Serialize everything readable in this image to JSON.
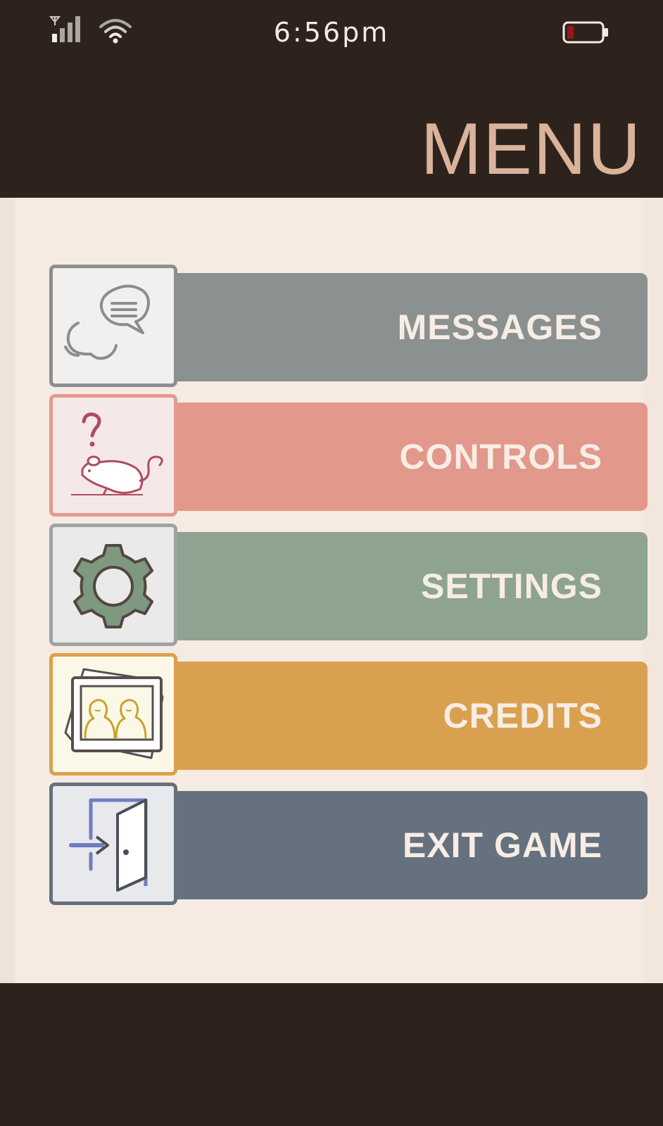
{
  "status_bar": {
    "time": "6:56pm",
    "signal_icon": "signal-icon",
    "wifi_icon": "wifi-icon",
    "battery_icon": "battery-low-icon"
  },
  "header": {
    "title": "MENU"
  },
  "menu": {
    "items": [
      {
        "label": "MESSAGES",
        "icon": "speech-bubbles-icon",
        "bar_color": "#8b9190",
        "tile_border": "#8c8f8f",
        "tile_bg": "#f1f0ef"
      },
      {
        "label": "CONTROLS",
        "icon": "confused-mouse-icon",
        "bar_color": "#e2988b",
        "tile_border": "#e39a8f",
        "tile_bg": "#f5e9e7"
      },
      {
        "label": "SETTINGS",
        "icon": "gear-icon",
        "bar_color": "#8ea390",
        "tile_border": "#a0a3a3",
        "tile_bg": "#ebeaea"
      },
      {
        "label": "CREDITS",
        "icon": "photo-frame-icon",
        "bar_color": "#d9a14f",
        "tile_border": "#dba04e",
        "tile_bg": "#fcf8e7"
      },
      {
        "label": "EXIT GAME",
        "icon": "exit-door-icon",
        "bar_color": "#65717e",
        "tile_border": "#64707c",
        "tile_bg": "#e8e9ed"
      }
    ]
  },
  "colors": {
    "background": "#2d231c",
    "panel": "#f6ebe3",
    "title": "#d9b39c",
    "label_text": "#f7ede4"
  }
}
